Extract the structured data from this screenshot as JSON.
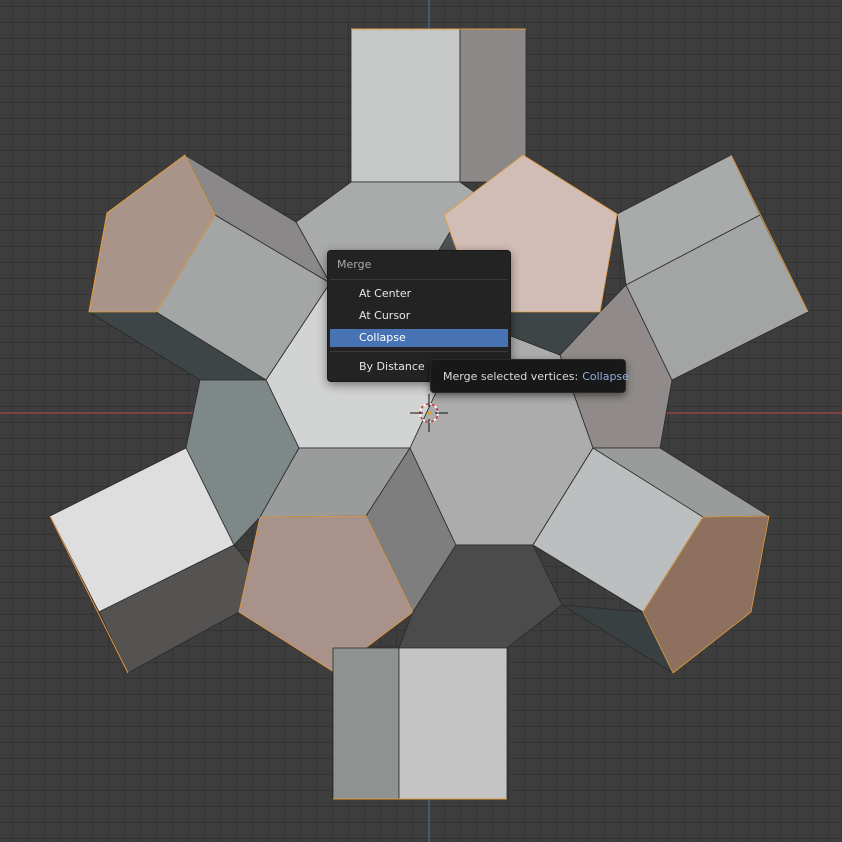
{
  "menu": {
    "title": "Merge",
    "items": [
      {
        "label": "At Center",
        "active": false
      },
      {
        "label": "At Cursor",
        "active": false
      },
      {
        "label": "Collapse",
        "active": true
      },
      {
        "label": "By Distance",
        "active": false
      }
    ]
  },
  "tooltip": {
    "text": "Merge selected vertices:",
    "value": "Collapse"
  },
  "colors": {
    "grid_background": "#3d3d3d",
    "axis_x": "#a54848",
    "axis_y": "#4a6fa0",
    "selection_edge": "#e09a3c",
    "menu_highlight": "#4772b3"
  }
}
